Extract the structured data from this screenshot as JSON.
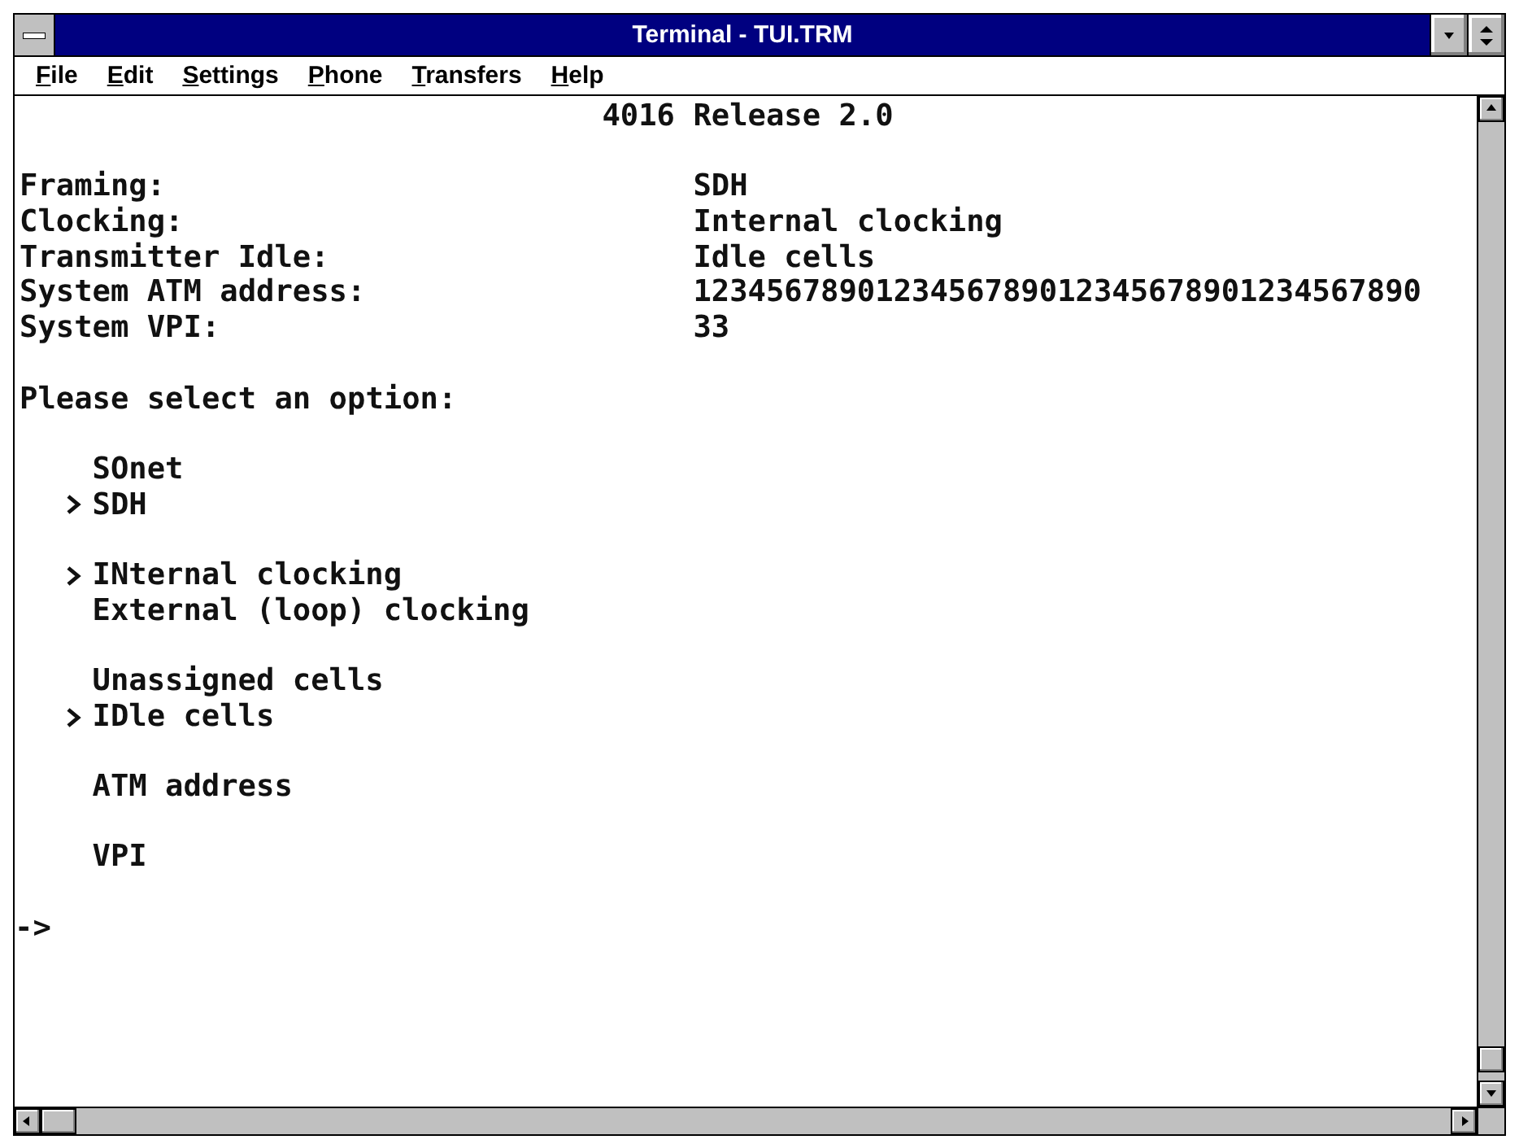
{
  "window": {
    "title": "Terminal - TUI.TRM"
  },
  "menu": [
    {
      "label": "File"
    },
    {
      "label": "Edit"
    },
    {
      "label": "Settings"
    },
    {
      "label": "Phone"
    },
    {
      "label": "Transfers"
    },
    {
      "label": "Help"
    }
  ],
  "terminal": {
    "header": "4016 Release 2.0",
    "fields": [
      {
        "label": "Framing:",
        "value": "SDH"
      },
      {
        "label": "Clocking:",
        "value": "Internal clocking"
      },
      {
        "label": "Transmitter Idle:",
        "value": "Idle cells"
      },
      {
        "label": "System ATM address:",
        "value": "1234567890123456789012345678901234567890"
      },
      {
        "label": "System VPI:",
        "value": "33"
      }
    ],
    "prompt": "Please select an option:",
    "option_groups": [
      {
        "options": [
          {
            "text": "SOnet",
            "selected": false
          },
          {
            "text": "SDH",
            "selected": true
          }
        ]
      },
      {
        "options": [
          {
            "text": "INternal clocking",
            "selected": true
          },
          {
            "text": "External (loop) clocking",
            "selected": false
          }
        ]
      },
      {
        "options": [
          {
            "text": "Unassigned cells",
            "selected": false
          },
          {
            "text": "IDle cells",
            "selected": true
          }
        ]
      },
      {
        "options": [
          {
            "text": "ATM address",
            "selected": false
          }
        ]
      },
      {
        "options": [
          {
            "text": "VPI",
            "selected": false
          }
        ]
      }
    ],
    "command_prompt": "->"
  }
}
